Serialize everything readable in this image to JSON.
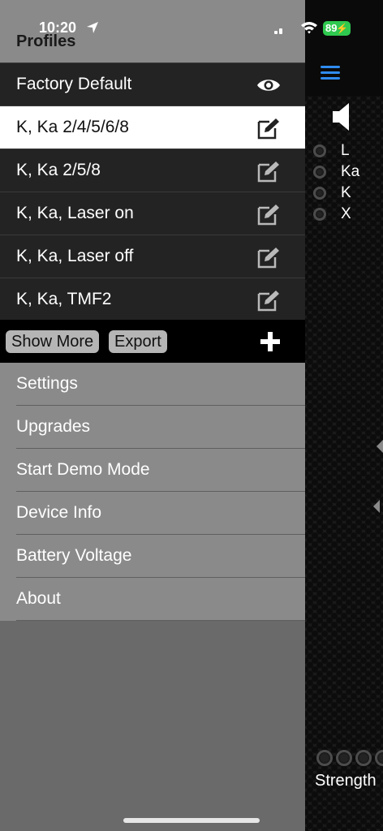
{
  "status_bar": {
    "time": "10:20",
    "battery": "89"
  },
  "drawer": {
    "title": "Profiles",
    "profiles": [
      {
        "label": "Factory Default",
        "icon": "eye-icon",
        "selected": false
      },
      {
        "label": "K, Ka 2/4/5/6/8",
        "icon": "edit-icon",
        "selected": true
      },
      {
        "label": "K, Ka 2/5/8",
        "icon": "edit-icon",
        "selected": false
      },
      {
        "label": "K, Ka, Laser on",
        "icon": "edit-icon",
        "selected": false
      },
      {
        "label": "K, Ka, Laser off",
        "icon": "edit-icon",
        "selected": false
      },
      {
        "label": "K, Ka, TMF2",
        "icon": "edit-icon",
        "selected": false
      }
    ],
    "actions": {
      "show_more": "Show More",
      "export": "Export",
      "add_icon": "plus-icon"
    },
    "menu": [
      "Settings",
      "Upgrades",
      "Start Demo Mode",
      "Device Info",
      "Battery Voltage",
      "About"
    ]
  },
  "background_app": {
    "bands": [
      "L",
      "Ka",
      "K",
      "X"
    ],
    "strength_label": "Strength",
    "accent_color": "#2f8cf0"
  }
}
